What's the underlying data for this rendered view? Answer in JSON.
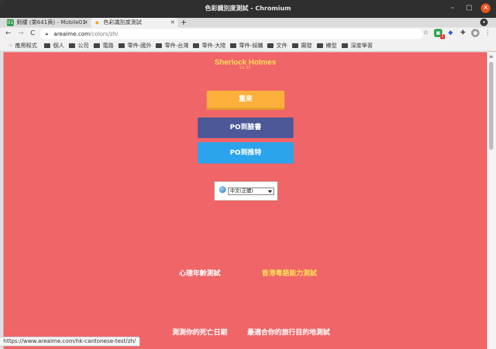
{
  "window": {
    "title": "色彩識別度測試 - Chromium",
    "minimize": "–",
    "maximize": "□",
    "close": "✕"
  },
  "tabs": [
    {
      "label": "剣樓 (第641頁) - Mobile01",
      "favicon": "01",
      "favicon_color": "#2e9c46",
      "close": "✕"
    },
    {
      "label": "色彩識別度測試",
      "favicon": "◆",
      "favicon_color": "#f39c12",
      "close": "✕"
    }
  ],
  "newtab": "+",
  "toolbar": {
    "back": "←",
    "forward": "→",
    "reload": "C",
    "url_host": "arealme.com",
    "url_path": "/colors/zh/",
    "star": "☆",
    "ext_badge": "1",
    "menu": "⋮"
  },
  "bookmarks": [
    {
      "label": "應用程式",
      "icon": "apps-grid"
    },
    {
      "label": "個人",
      "icon": "folder"
    },
    {
      "label": "公司",
      "icon": "folder"
    },
    {
      "label": "電路",
      "icon": "folder"
    },
    {
      "label": "零件-國外",
      "icon": "folder"
    },
    {
      "label": "零件-台灣",
      "icon": "folder"
    },
    {
      "label": "零件-大陸",
      "icon": "folder"
    },
    {
      "label": "零件-採購",
      "icon": "folder"
    },
    {
      "label": "文件",
      "icon": "folder"
    },
    {
      "label": "開發",
      "icon": "folder"
    },
    {
      "label": "模型",
      "icon": "folder"
    },
    {
      "label": "深度學習",
      "icon": "folder"
    }
  ],
  "result": {
    "name": "Sherlock Holmes",
    "level": "Lv. 37"
  },
  "buttons": {
    "restart": "重来",
    "facebook": "PO到臉書",
    "twitter": "PO到推特"
  },
  "language": {
    "selected": "中文(正體)"
  },
  "links": [
    {
      "label": "心理年齡測試",
      "color": "white"
    },
    {
      "label": "香港粵語能力測試",
      "color": "yellow"
    },
    {
      "label": "測測你的死亡日期",
      "color": "white"
    },
    {
      "label": "最適合你的旅行目的地測試",
      "color": "white"
    }
  ],
  "status_url": "https://www.arealme.com/hk-cantonese-test/zh/",
  "colors": {
    "page_bg": "#f06567",
    "accent_yellow": "#ffde59",
    "restart_btn": "#fbb03b",
    "facebook_btn": "#4c5898",
    "twitter_btn": "#2ca4ec"
  }
}
